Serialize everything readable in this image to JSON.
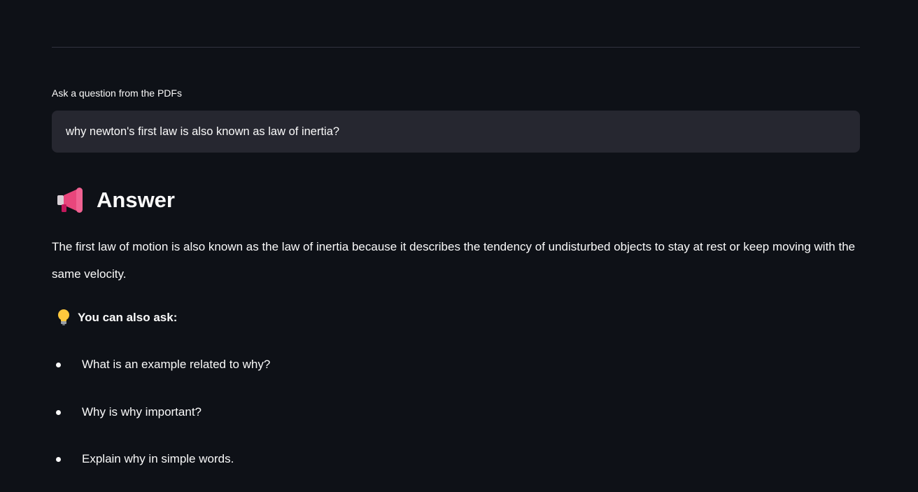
{
  "question": {
    "label": "Ask a question from the PDFs",
    "value": "why newton's first law is also known as law of inertia?"
  },
  "answer": {
    "heading": "Answer",
    "heading_icon": "megaphone-icon",
    "text": "The first law of motion is also known as the law of inertia because it describes the tendency of undisturbed objects to stay at rest or keep moving with the same velocity."
  },
  "suggestions": {
    "heading": "You can also ask:",
    "heading_icon": "lightbulb-icon",
    "items": [
      {
        "label": "What is an example related to why?"
      },
      {
        "label": "Why is why important?"
      },
      {
        "label": "Explain why in simple words."
      }
    ]
  },
  "colors": {
    "background": "#0e1117",
    "input_background": "#262730",
    "text": "#fafafa",
    "divider": "#31333f"
  }
}
